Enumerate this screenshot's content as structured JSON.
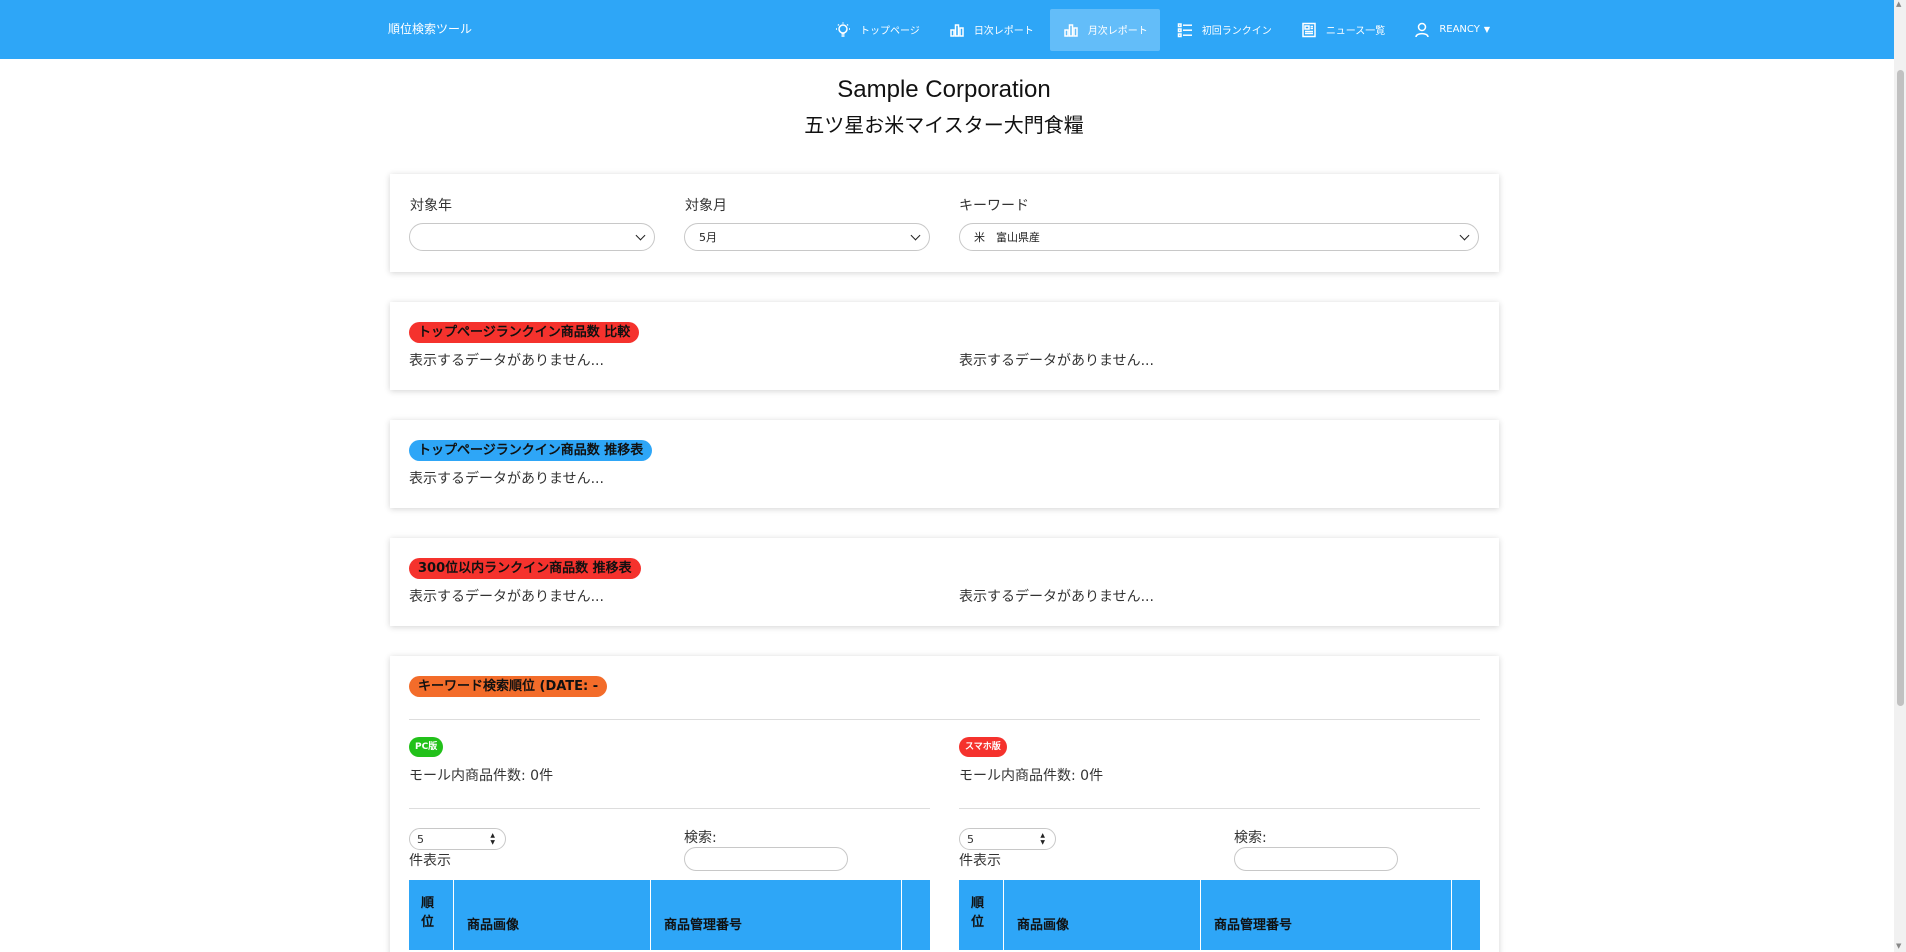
{
  "navbar": {
    "brand": "順位検索ツール",
    "items": [
      {
        "label": "トップページ",
        "icon": "lightbulb-icon",
        "active": false
      },
      {
        "label": "日次レポート",
        "icon": "bar-chart-icon",
        "active": false
      },
      {
        "label": "月次レポート",
        "icon": "bar-chart-icon",
        "active": true
      },
      {
        "label": "初回ランクイン",
        "icon": "list-icon",
        "active": false
      },
      {
        "label": "ニュース一覧",
        "icon": "newspaper-icon",
        "active": false
      },
      {
        "label": "REANCY",
        "icon": "user-icon",
        "active": false
      }
    ]
  },
  "header": {
    "company": "Sample Corporation",
    "shop": "五ツ星お米マイスター大門食糧"
  },
  "filters": {
    "year_label": "対象年",
    "year_value": "",
    "month_label": "対象月",
    "month_value": "5月",
    "keyword_label": "キーワード",
    "keyword_value": "米　富山県産"
  },
  "sections": {
    "compare": {
      "title": "トップページランクイン商品数 比較",
      "left_empty": "表示するデータがありません...",
      "right_empty": "表示するデータがありません..."
    },
    "trend": {
      "title": "トップページランクイン商品数 推移表",
      "empty": "表示するデータがありません..."
    },
    "top300": {
      "title": "300位以内ランクイン商品数 推移表",
      "left_empty": "表示するデータがありません...",
      "right_empty": "表示するデータがありません..."
    },
    "keyword_rank": {
      "title": "キーワード検索順位 (DATE: -",
      "pc": {
        "badge": "PC版",
        "count": "モール内商品件数: 0件",
        "page_size": "5",
        "show_label": "件表示",
        "search_label": "検索:",
        "columns": [
          "順位",
          "商品画像",
          "商品管理番号"
        ]
      },
      "sp": {
        "badge": "スマホ版",
        "count": "モール内商品件数: 0件",
        "page_size": "5",
        "show_label": "件表示",
        "search_label": "検索:",
        "columns": [
          "順位",
          "商品画像",
          "商品管理番号"
        ]
      }
    }
  },
  "colors": {
    "primary": "#2ea6f7",
    "red_badge": "#f5322d",
    "blue_badge": "#2ea6f7",
    "orange_badge": "#f36c2a",
    "green_badge": "#22c11a"
  }
}
